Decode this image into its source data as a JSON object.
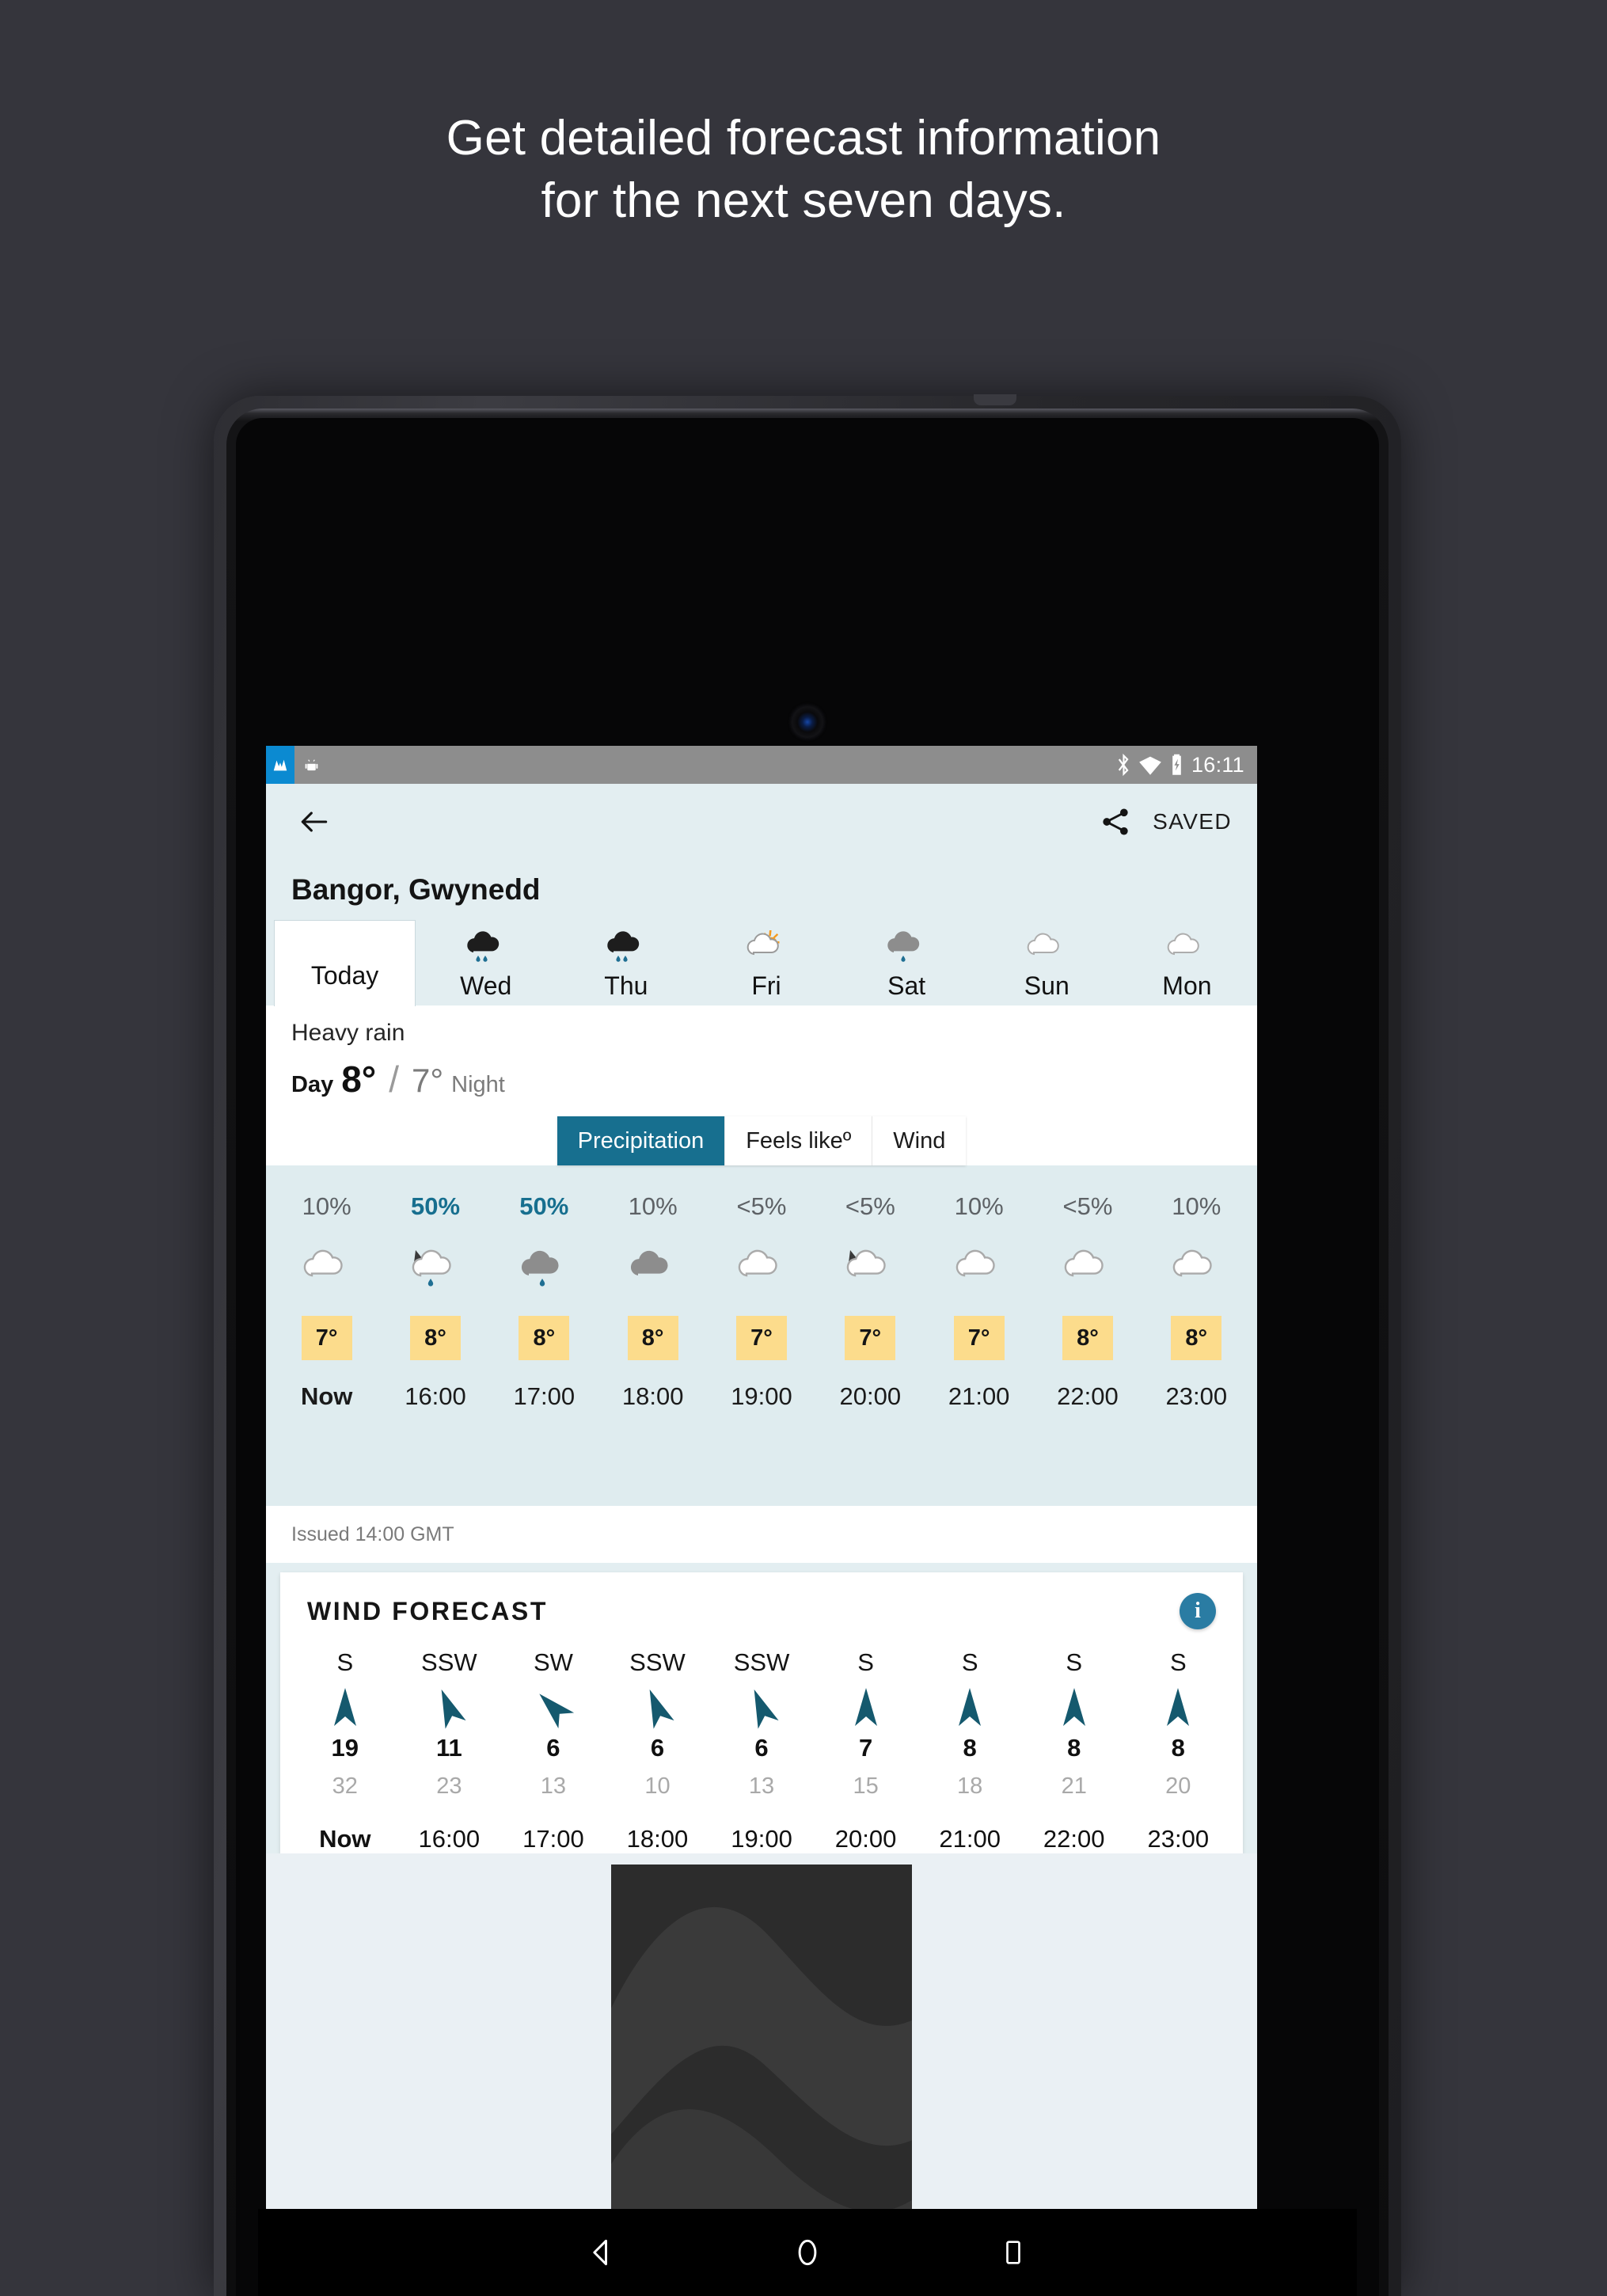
{
  "promo": {
    "line1": "Get detailed forecast information",
    "line2": "for the next seven days."
  },
  "statusbar": {
    "time": "16:11",
    "icons": [
      "app-icon",
      "android-icon",
      "bluetooth-icon",
      "wifi-icon",
      "battery-charging-icon"
    ]
  },
  "appbar": {
    "back_label": "",
    "share_label": "",
    "saved_label": "SAVED"
  },
  "location": {
    "name": "Bangor, Gwynedd"
  },
  "day_tabs": [
    {
      "label": "Today",
      "icon": "none",
      "active": true
    },
    {
      "label": "Wed",
      "icon": "heavy-rain",
      "active": false
    },
    {
      "label": "Thu",
      "icon": "heavy-rain",
      "active": false
    },
    {
      "label": "Fri",
      "icon": "sunny-intervals",
      "active": false
    },
    {
      "label": "Sat",
      "icon": "light-rain-grey",
      "active": false
    },
    {
      "label": "Sun",
      "icon": "cloudy",
      "active": false
    },
    {
      "label": "Mon",
      "icon": "cloudy",
      "active": false
    }
  ],
  "summary": {
    "condition": "Heavy rain",
    "day_label": "Day",
    "day_temp": "8°",
    "separator": "/",
    "night_temp": "7°",
    "night_label": "Night"
  },
  "metric_tabs": [
    {
      "label": "Precipitation",
      "active": true
    },
    {
      "label": "Feels likeº",
      "active": false
    },
    {
      "label": "Wind",
      "active": false
    }
  ],
  "hourly": {
    "columns": [
      {
        "precip": "10%",
        "highlight": false,
        "icon": "cloudy",
        "temp": "7°",
        "time": "Now",
        "now": true
      },
      {
        "precip": "50%",
        "highlight": true,
        "icon": "sun-rain",
        "temp": "8°",
        "time": "16:00",
        "now": false
      },
      {
        "precip": "50%",
        "highlight": true,
        "icon": "grey-rain",
        "temp": "8°",
        "time": "17:00",
        "now": false
      },
      {
        "precip": "10%",
        "highlight": false,
        "icon": "grey-cloud",
        "temp": "8°",
        "time": "18:00",
        "now": false
      },
      {
        "precip": "<5%",
        "highlight": false,
        "icon": "cloudy",
        "temp": "7°",
        "time": "19:00",
        "now": false
      },
      {
        "precip": "<5%",
        "highlight": false,
        "icon": "night-cloud",
        "temp": "7°",
        "time": "20:00",
        "now": false
      },
      {
        "precip": "10%",
        "highlight": false,
        "icon": "cloudy",
        "temp": "7°",
        "time": "21:00",
        "now": false
      },
      {
        "precip": "<5%",
        "highlight": false,
        "icon": "cloudy",
        "temp": "8°",
        "time": "22:00",
        "now": false
      },
      {
        "precip": "10%",
        "highlight": false,
        "icon": "cloudy",
        "temp": "8°",
        "time": "23:00",
        "now": false
      }
    ]
  },
  "issued": {
    "text": "Issued 14:00 GMT"
  },
  "wind": {
    "title": "WIND FORECAST",
    "info_label": "i",
    "columns": [
      {
        "dir": "S",
        "deg": 0,
        "speed": "19",
        "gust": "32",
        "time": "Now",
        "now": true
      },
      {
        "dir": "SSW",
        "deg": -22,
        "speed": "11",
        "gust": "23",
        "time": "16:00",
        "now": false
      },
      {
        "dir": "SW",
        "deg": -45,
        "speed": "6",
        "gust": "13",
        "time": "17:00",
        "now": false
      },
      {
        "dir": "SSW",
        "deg": -22,
        "speed": "6",
        "gust": "10",
        "time": "18:00",
        "now": false
      },
      {
        "dir": "SSW",
        "deg": -22,
        "speed": "6",
        "gust": "13",
        "time": "19:00",
        "now": false
      },
      {
        "dir": "S",
        "deg": 0,
        "speed": "7",
        "gust": "15",
        "time": "20:00",
        "now": false
      },
      {
        "dir": "S",
        "deg": 0,
        "speed": "8",
        "gust": "18",
        "time": "21:00",
        "now": false
      },
      {
        "dir": "S",
        "deg": 0,
        "speed": "8",
        "gust": "21",
        "time": "22:00",
        "now": false
      },
      {
        "dir": "S",
        "deg": 0,
        "speed": "8",
        "gust": "20",
        "time": "23:00",
        "now": false
      }
    ]
  },
  "navbar": {
    "back": "back-triangle-icon",
    "home": "home-circle-icon",
    "recents": "recents-square-icon"
  },
  "colors": {
    "page_bg": "#35353c",
    "app_bg": "#e3eef1",
    "panel_bg": "#dfecef",
    "accent": "#176f8f",
    "temp_chip": "#fcdc8c",
    "arrow": "#15596e",
    "muted": "#a9a9a9"
  }
}
